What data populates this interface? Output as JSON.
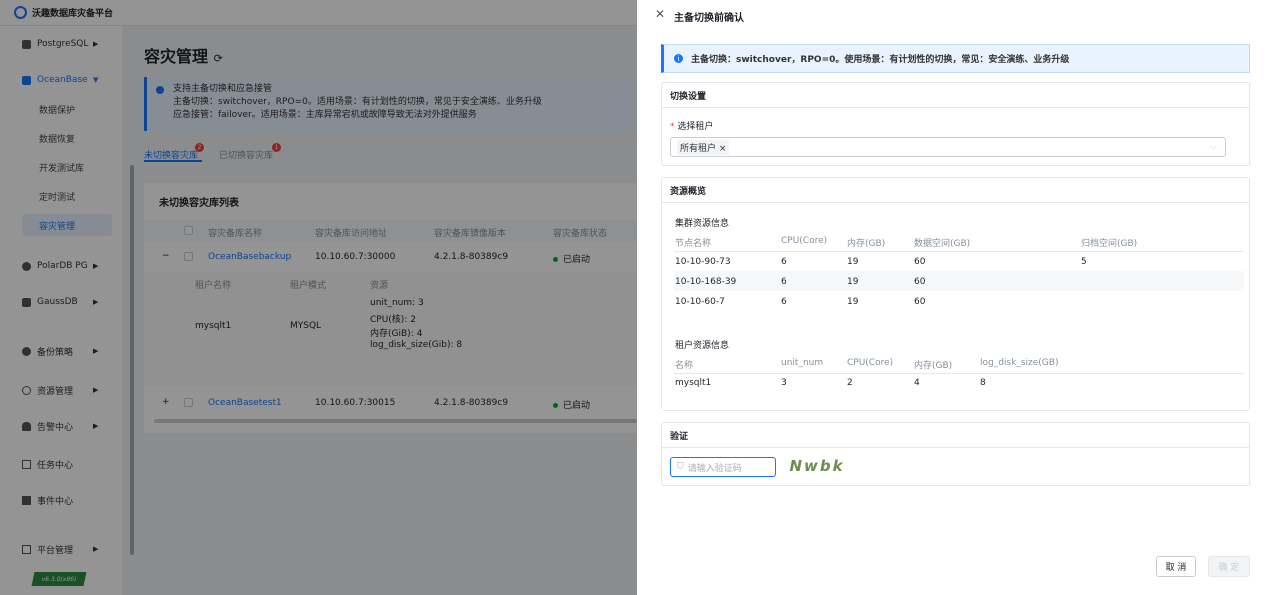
{
  "app": {
    "brand": "沃趣数据库灾备平台",
    "version": "v6.3.0(x86)"
  },
  "sidebar": {
    "items": [
      {
        "label": "PostgreSQL"
      },
      {
        "label": "OceanBase"
      },
      {
        "label": "PolarDB PG"
      },
      {
        "label": "GaussDB"
      },
      {
        "label": "备份策略"
      },
      {
        "label": "资源管理"
      },
      {
        "label": "告警中心"
      },
      {
        "label": "任务中心"
      },
      {
        "label": "事件中心"
      },
      {
        "label": "平台管理"
      }
    ],
    "sub_items": [
      "数据保护",
      "数据恢复",
      "开发测试库",
      "定时测试",
      "容灾管理"
    ]
  },
  "main": {
    "title": "容灾管理",
    "alert": {
      "title": "支持主备切换和应急接管",
      "line1": "主备切换：switchover，RPO=0。适用场景：有计划性的切换，常见于安全演练、业务升级",
      "line2": "应急接管：failover。适用场景：主库异常宕机或故障导致无法对外提供服务"
    },
    "tabs": [
      {
        "label": "未切换容灾库",
        "badge": "2"
      },
      {
        "label": "已切换容灾库",
        "badge": "1"
      }
    ],
    "table_title": "未切换容灾库列表",
    "columns": [
      "容灾备库名称",
      "容灾备库访问地址",
      "容灾备库镜像版本",
      "容灾备库状态"
    ],
    "rows": [
      {
        "expand": "−",
        "name": "OceanBasebackup",
        "addr": "10.10.60.7:30000",
        "ver": "4.2.1.8-80389c9",
        "status": "已启动"
      },
      {
        "expand": "+",
        "name": "OceanBasetest1",
        "addr": "10.10.60.7:30015",
        "ver": "4.2.1.8-80389c9",
        "status": "已启动"
      }
    ],
    "sub_columns": [
      "租户名称",
      "租户模式",
      "资源"
    ],
    "sub_row": {
      "tenant": "mysqlt1",
      "mode": "MYSQL",
      "res": [
        "unit_num: 3",
        "CPU(核): 2",
        "内存(GiB): 4",
        "log_disk_size(Gib): 8"
      ]
    }
  },
  "drawer": {
    "title": "主备切换前确认",
    "info": "主备切换：switchover，RPO=0。使用场景：有计划性的切换，常见：安全演练、业务升级",
    "settings": {
      "head": "切换设置",
      "label": "选择租户",
      "tag": "所有租户 ×"
    },
    "resource": {
      "head": "资源概览",
      "cluster_title": "集群资源信息",
      "cluster_cols": [
        "节点名称",
        "CPU(Core)",
        "内存(GB)",
        "数据空间(GB)",
        "归档空间(GB)"
      ],
      "cluster_rows": [
        [
          "10-10-90-73",
          "6",
          "19",
          "60",
          "5"
        ],
        [
          "10-10-168-39",
          "6",
          "19",
          "60",
          ""
        ],
        [
          "10-10-60-7",
          "6",
          "19",
          "60",
          ""
        ]
      ],
      "tenant_title": "租户资源信息",
      "tenant_cols": [
        "名称",
        "unit_num",
        "CPU(Core)",
        "内存(GB)",
        "log_disk_size(GB)"
      ],
      "tenant_rows": [
        [
          "mysqlt1",
          "3",
          "2",
          "4",
          "8"
        ]
      ]
    },
    "verify": {
      "head": "验证",
      "placeholder": "请输入验证码",
      "captcha": "Nwbk"
    },
    "buttons": {
      "cancel": "取 消",
      "confirm": "确 定"
    }
  }
}
